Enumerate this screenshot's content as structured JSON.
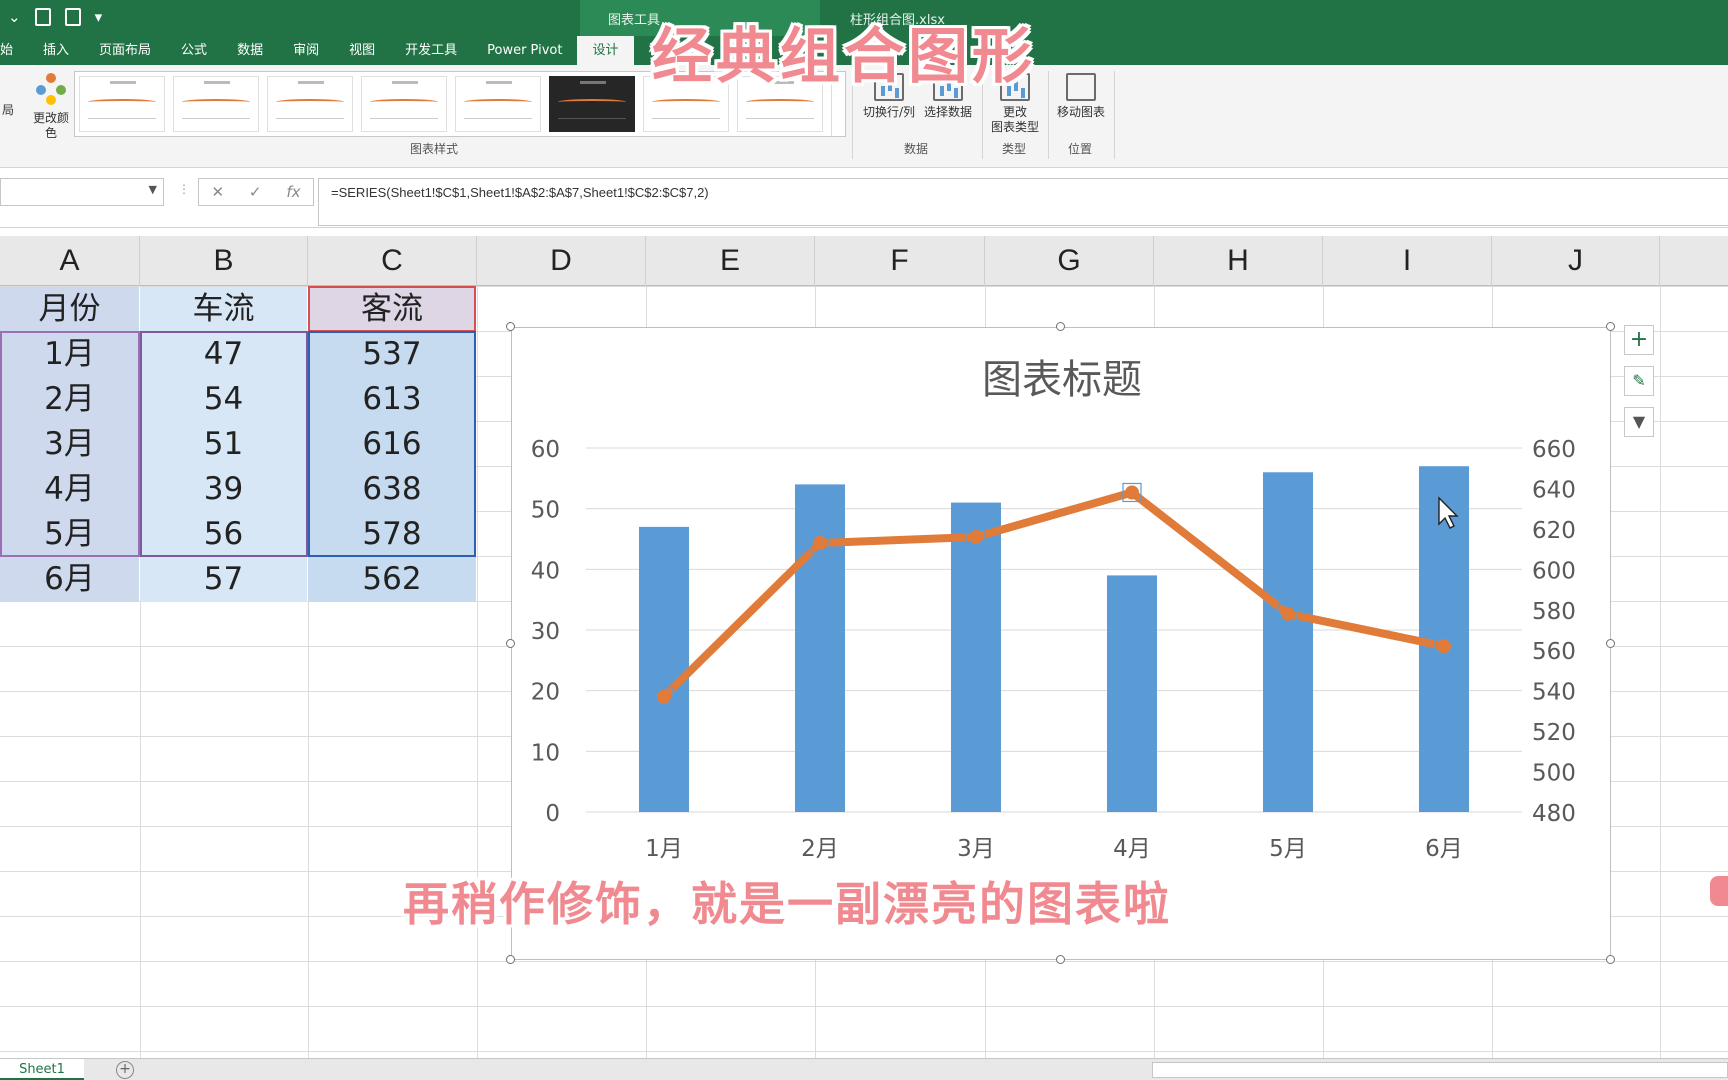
{
  "ribbon": {
    "context_label": "图表工具",
    "filename": "柱形组合图.xlsx",
    "tabs": [
      "始",
      "插入",
      "页面布局",
      "公式",
      "数据",
      "审阅",
      "视图",
      "开发工具",
      "Power Pivot",
      "设计",
      "格式"
    ],
    "active_tab": "设计",
    "change_colors": "更改颜色",
    "layout_fragment": "局",
    "gallery_label": "图表样式",
    "switch_row_col": "切换行/列",
    "select_data": "选择数据",
    "data_group": "数据",
    "change_type_line1": "更改",
    "change_type_line2": "图表类型",
    "type_group": "类型",
    "move_chart": "移动图表",
    "location_group": "位置"
  },
  "formula_bar": {
    "name_box": "",
    "cancel": "✕",
    "enter": "✓",
    "fx": "fx",
    "formula": "=SERIES(Sheet1!$C$1,Sheet1!$A$2:$A$7,Sheet1!$C$2:$C$7,2)"
  },
  "columns": [
    "A",
    "B",
    "C",
    "D",
    "E",
    "F",
    "G",
    "H",
    "I",
    "J"
  ],
  "table": {
    "headers": [
      "月份",
      "车流",
      "客流"
    ],
    "rows": [
      [
        "1月",
        "47",
        "537"
      ],
      [
        "2月",
        "54",
        "613"
      ],
      [
        "3月",
        "51",
        "616"
      ],
      [
        "4月",
        "39",
        "638"
      ],
      [
        "5月",
        "56",
        "578"
      ],
      [
        "6月",
        "57",
        "562"
      ]
    ]
  },
  "chart_data": {
    "type": "bar",
    "title": "图表标题",
    "categories": [
      "1月",
      "2月",
      "3月",
      "4月",
      "5月",
      "6月"
    ],
    "series": [
      {
        "name": "车流",
        "type": "bar",
        "axis": "primary",
        "values": [
          47,
          54,
          51,
          39,
          56,
          57
        ],
        "color": "#5b9bd5"
      },
      {
        "name": "客流",
        "type": "line",
        "axis": "secondary",
        "values": [
          537,
          613,
          616,
          638,
          578,
          562
        ],
        "color": "#e07b39"
      }
    ],
    "ylim": [
      0,
      60
    ],
    "yticks": [
      0,
      10,
      20,
      30,
      40,
      50,
      60
    ],
    "y2lim": [
      480,
      660
    ],
    "y2ticks": [
      480,
      500,
      520,
      540,
      560,
      580,
      600,
      620,
      640,
      660
    ],
    "grid": true,
    "legend": "bottom"
  },
  "overlays": {
    "title": "经典组合图形",
    "subtitle": "再稍作修饰，就是一副漂亮的图表啦"
  },
  "sheet": {
    "tab": "Sheet1",
    "add": "+"
  },
  "icons": [
    "change-colors-icon",
    "switch-row-col-icon",
    "select-data-icon",
    "change-chart-type-icon",
    "move-chart-icon",
    "chart-elements-icon",
    "chart-styles-icon",
    "chart-filter-icon",
    "mouse-cursor-icon"
  ]
}
